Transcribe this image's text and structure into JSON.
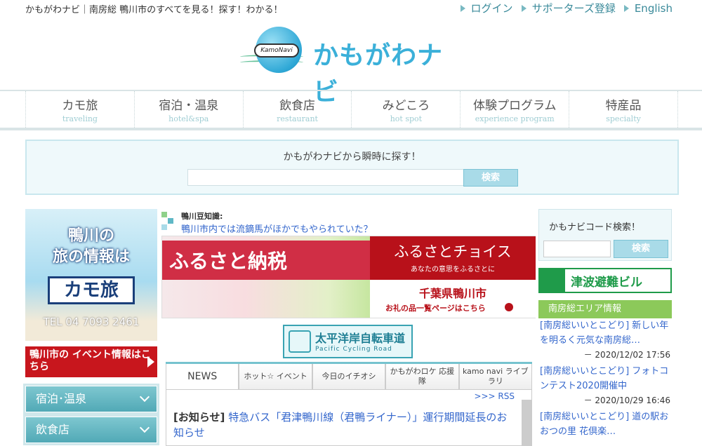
{
  "header": {
    "tagline": "かもがわナビ｜南房総 鴨川市のすべてを見る！探す！わかる！",
    "links": [
      "ログイン",
      "サポーターズ登録",
      "English"
    ],
    "logo_badge": "KamoNavi",
    "logo_name": "かもがわナビ"
  },
  "nav": [
    {
      "jp": "カモ旅",
      "en": "traveling"
    },
    {
      "jp": "宿泊・温泉",
      "en": "hotel&spa"
    },
    {
      "jp": "飲食店",
      "en": "restaurant"
    },
    {
      "jp": "みどころ",
      "en": "hot spot"
    },
    {
      "jp": "体験プログラム",
      "en": "experience program"
    },
    {
      "jp": "特産品",
      "en": "specialty"
    }
  ],
  "search": {
    "title": "かもがわナビから瞬時に探す！",
    "button": "検索"
  },
  "left": {
    "banner_line1": "鴨川の",
    "banner_line2": "旅の情報は",
    "banner_brand": "カモ旅",
    "banner_tel": "TEL 04 7093 2461",
    "event_banner": "鴨川市の イベント情報はこちら",
    "accordion": [
      "宿泊･温泉",
      "飲食店"
    ]
  },
  "center": {
    "trivia_label": "鴨川豆知識:",
    "trivia_link": "鴨川市内では流鏑馬がほかでもやられていた？",
    "furusato_left": "ふるさと納税",
    "furusato_choice": "ふるさとチョイス",
    "furusato_sub": "あなたの意思をふるさとに",
    "furusato_city": "千葉県鴨川市",
    "furusato_list": "お礼の品一覧ページはこちら",
    "cycle_title": "太平洋岸自転車道",
    "cycle_en": "Pacific Cycling Road",
    "tabs": [
      "NEWS",
      "ホット☆ イベント",
      "今日のイチオシ",
      "かもがわロケ 応援隊",
      "kamo navi ライブラリ"
    ],
    "rss": ">>> RSS",
    "news_tag": "[お知らせ]",
    "news_text": "特急バス「君津鴨川線（君鴨ライナー）」運行期間延長のお知らせ"
  },
  "right": {
    "code_title": "かもナビコード検索！",
    "code_button": "検索",
    "tsunami": "津波避難ビル",
    "area_title": "南房総エリア情報",
    "feed": [
      {
        "text": "[南房総いいとこどり] 新しい年を明るく元気な南房総…",
        "date": "－ 2020/12/02 17:56"
      },
      {
        "text": "[南房総いいとこどり] フォトコンテスト2020開催中",
        "date": "－ 2020/10/29 16:46"
      },
      {
        "text": "[南房総いいとこどり] 道の駅おおつの里 花倶楽…",
        "date": ""
      }
    ]
  }
}
